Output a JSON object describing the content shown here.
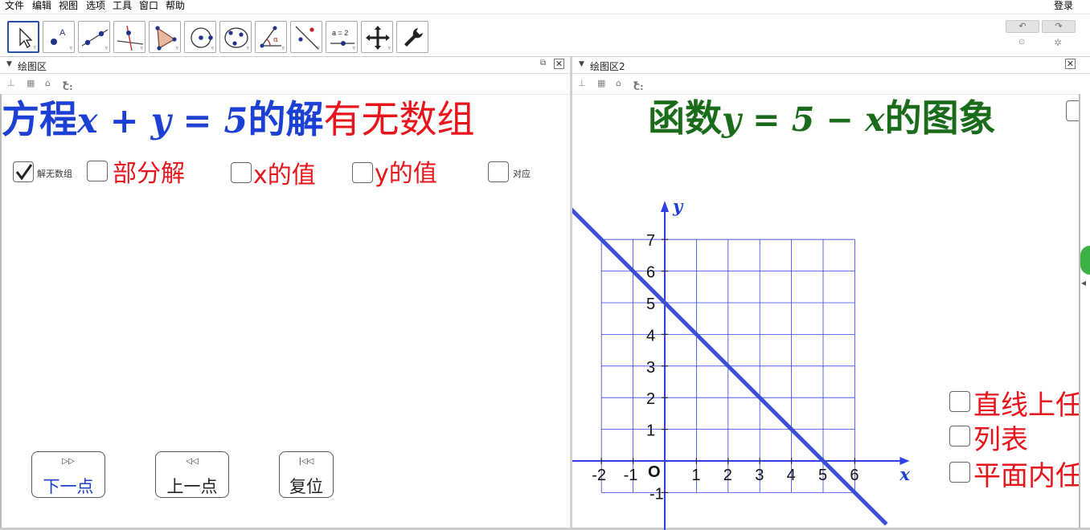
{
  "menu": {
    "items": [
      "文件",
      "编辑",
      "视图",
      "选项",
      "工具",
      "窗口",
      "帮助"
    ],
    "login": "登录"
  },
  "toolbar": {
    "tools": [
      {
        "icon": "move-arrow-icon"
      },
      {
        "icon": "point-icon",
        "label": "A"
      },
      {
        "icon": "line-icon"
      },
      {
        "icon": "perpendicular-line-icon"
      },
      {
        "icon": "polygon-icon"
      },
      {
        "icon": "circle-center-icon"
      },
      {
        "icon": "circle-three-points-icon"
      },
      {
        "icon": "angle-icon",
        "label": "α"
      },
      {
        "icon": "reflect-icon"
      },
      {
        "icon": "slider-icon",
        "label": "a = 2"
      },
      {
        "icon": "move-view-icon"
      },
      {
        "icon": "wrench-icon"
      }
    ],
    "undo_icon": "undo-icon",
    "redo_icon": "redo-icon"
  },
  "panel1": {
    "title": "绘图区",
    "graphics_style": "C:",
    "heading_part1": "方程",
    "heading_math": "x + y = 5",
    "heading_part2": "的解",
    "heading_part3": "有无数组",
    "checkboxes": [
      {
        "label": "解无数组",
        "checked": true
      },
      {
        "label": "部分解",
        "checked": false
      },
      {
        "label": "x的值",
        "checked": false
      },
      {
        "label": "y的值",
        "checked": false
      },
      {
        "label": "对应",
        "checked": false
      }
    ],
    "buttons": [
      {
        "icon_text": "▷▷",
        "label": "下一点"
      },
      {
        "icon_text": "◁◁",
        "label": "上一点"
      },
      {
        "icon_text": "|◁◁",
        "label": "复位"
      }
    ]
  },
  "panel2": {
    "title": "绘图区2",
    "graphics_style": "C:",
    "heading_part1": "函数",
    "heading_math": "y = 5 − x",
    "heading_part2": "的图象",
    "side_checkboxes": [
      {
        "label": "直线上任",
        "checked": false
      },
      {
        "label": "列表",
        "checked": false
      },
      {
        "label": "平面内任",
        "checked": false
      }
    ],
    "graph": {
      "x_axis_label": "x",
      "y_axis_label": "y",
      "origin_label": "O",
      "x_ticks": [
        "-2",
        "-1",
        "1",
        "2",
        "3",
        "4",
        "5",
        "6"
      ],
      "y_ticks": [
        "-1",
        "1",
        "2",
        "3",
        "4",
        "5",
        "6",
        "7"
      ]
    }
  },
  "chart_data": {
    "type": "line",
    "title": "",
    "xlabel": "x",
    "ylabel": "y",
    "xlim": [
      -2,
      6
    ],
    "ylim": [
      -1,
      7
    ],
    "grid": true,
    "series": [
      {
        "name": "",
        "x": [
          -3,
          7
        ],
        "y": [
          8,
          -2
        ],
        "color": "#3a4fd6"
      }
    ]
  },
  "colors": {
    "blue": "#1c3fd4",
    "red": "#e8141c",
    "green": "#1a6b1a",
    "grid": "#3040e8",
    "graph_line": "#3a4fd6"
  }
}
